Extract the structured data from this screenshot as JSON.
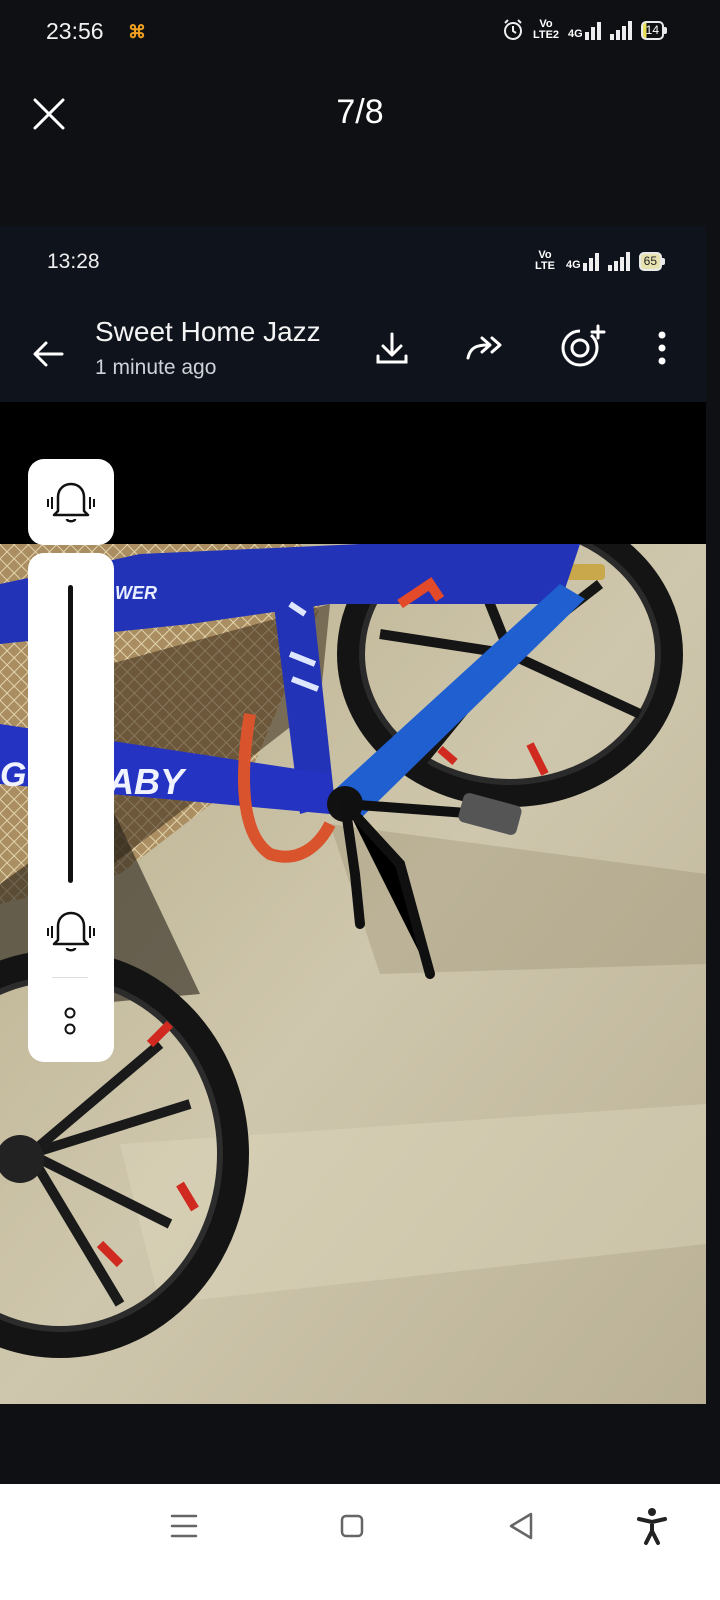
{
  "outer_status": {
    "time": "23:56",
    "battery": "14",
    "network_label": "4G",
    "volte_label": "Vo LTE2"
  },
  "viewer": {
    "page_counter": "7/8"
  },
  "inner_screen": {
    "status": {
      "time": "13:28",
      "battery": "65",
      "network_label": "4G",
      "volte_label": "Vo LTE"
    },
    "chat": {
      "title": "Sweet Home Jazz",
      "subtitle": "1 minute ago"
    },
    "photo": {
      "frame_text_1": "WER",
      "frame_text_2": "ABY",
      "frame_text_3": "G"
    }
  },
  "colors": {
    "dark_background": "#0e1014",
    "inner_bar": "#0f131b",
    "bike_blue": "#2233b8",
    "overlay_white": "#ffffff"
  },
  "icons": [
    "close-icon",
    "notification-icon",
    "alarm-icon",
    "back-arrow-icon",
    "download-icon",
    "forward-icon",
    "add-status-icon",
    "more-vert-icon",
    "bell-icon",
    "menu-icon",
    "home-square-icon",
    "back-triangle-icon",
    "accessibility-icon"
  ]
}
